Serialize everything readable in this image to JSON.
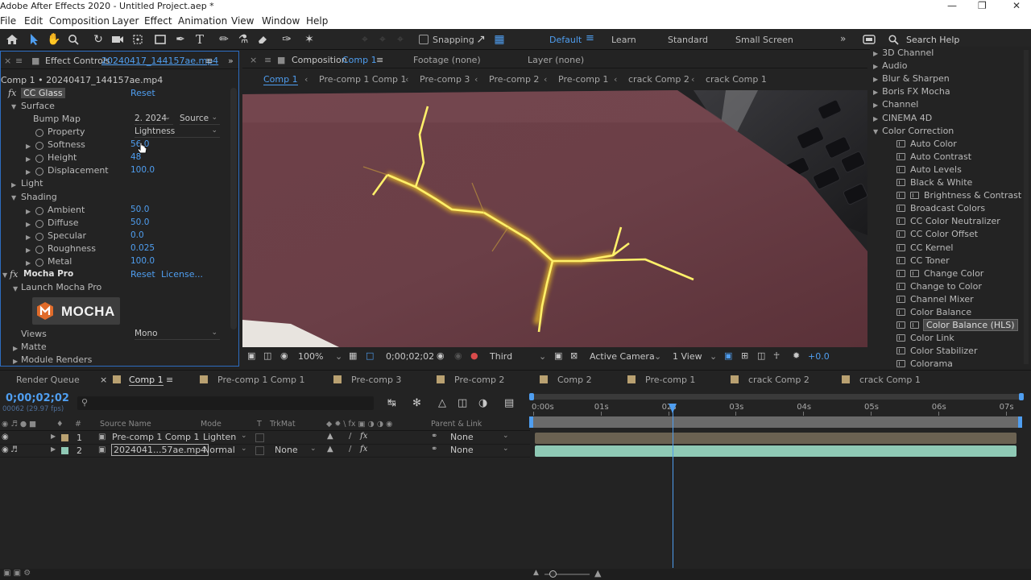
{
  "window": {
    "title": "Adobe After Effects 2020 - Untitled Project.aep *"
  },
  "menu": [
    "File",
    "Edit",
    "Composition",
    "Layer",
    "Effect",
    "Animation",
    "View",
    "Window",
    "Help"
  ],
  "toolbar": {
    "snapping": "Snapping",
    "workspaces": [
      "Default",
      "Learn",
      "Standard",
      "Small Screen"
    ],
    "search_placeholder": "Search Help"
  },
  "effect_controls": {
    "tab_prefix": "Effect Controls",
    "tab_file": "20240417_144157ae.mp4",
    "subtitle": "Comp 1 • 20240417_144157ae.mp4",
    "cc_glass": {
      "name": "CC Glass",
      "reset": "Reset",
      "surface": "Surface",
      "bump_map_label": "Bump Map",
      "bump_map_value": "2. 2024",
      "bump_map_source": "Source",
      "property_label": "Property",
      "property_value": "Lightness",
      "softness_label": "Softness",
      "softness_value": "56.0",
      "height_label": "Height",
      "height_value": "48",
      "displacement_label": "Displacement",
      "displacement_value": "100.0",
      "light": "Light",
      "shading": "Shading",
      "ambient_label": "Ambient",
      "ambient_value": "50.0",
      "diffuse_label": "Diffuse",
      "diffuse_value": "50.0",
      "specular_label": "Specular",
      "specular_value": "0.0",
      "roughness_label": "Roughness",
      "roughness_value": "0.025",
      "metal_label": "Metal",
      "metal_value": "100.0"
    },
    "mocha": {
      "name": "Mocha Pro",
      "reset": "Reset",
      "license": "License...",
      "launch": "Launch Mocha Pro",
      "logo_text": "MOCHA",
      "views_label": "Views",
      "views_value": "Mono",
      "matte": "Matte",
      "module_renders": "Module Renders"
    }
  },
  "composition": {
    "tab_prefix": "Composition",
    "tab_name": "Comp 1",
    "footage": "Footage (none)",
    "layer": "Layer (none)",
    "breadcrumbs": [
      "Comp 1",
      "Pre-comp 1 Comp 1",
      "Pre-comp 3",
      "Pre-comp 2",
      "Pre-comp 1",
      "crack Comp 2",
      "crack Comp 1"
    ],
    "zoom": "100%",
    "timecode": "0;00;02;02",
    "resolution": "Third",
    "camera": "Active Camera",
    "views": "1 View",
    "exposure": "+0.0"
  },
  "effects_presets": {
    "categories_top": [
      "3D Channel",
      "Audio",
      "Blur & Sharpen",
      "Boris FX Mocha",
      "Channel",
      "CINEMA 4D",
      "Color Correction"
    ],
    "color_correction": [
      "Auto Color",
      "Auto Contrast",
      "Auto Levels",
      "Black & White",
      "Brightness & Contrast",
      "Broadcast Colors",
      "CC Color Neutralizer",
      "CC Color Offset",
      "CC Kernel",
      "CC Toner",
      "Change Color",
      "Change to Color",
      "Channel Mixer",
      "Color Balance",
      "Color Balance (HLS)",
      "Color Link",
      "Color Stabilizer",
      "Colorama"
    ],
    "selected": "Color Balance (HLS)"
  },
  "timeline": {
    "tabs": [
      "Render Queue",
      "Comp 1",
      "Pre-comp 1 Comp 1",
      "Pre-comp 3",
      "Pre-comp 2",
      "Comp 2",
      "Pre-comp 1",
      "crack Comp 2",
      "crack Comp 1"
    ],
    "timecode": "0;00;02;02",
    "frame_info": "00062 (29.97 fps)",
    "columns": {
      "source": "Source Name",
      "mode": "Mode",
      "t": "T",
      "trkmat": "TrkMat",
      "parent": "Parent & Link"
    },
    "layers": [
      {
        "num": "1",
        "name": "Pre-comp 1 Comp 1",
        "mode": "Lighten",
        "trkmat": "",
        "parent": "None",
        "color": "#b9a171"
      },
      {
        "num": "2",
        "name": "2024041...57ae.mp4",
        "mode": "Normal",
        "trkmat": "None",
        "parent": "None",
        "color": "#8fc9b5"
      }
    ],
    "ruler": [
      "0:00s",
      "01s",
      "02s",
      "03s",
      "04s",
      "05s",
      "06s",
      "07s"
    ],
    "playhead_seconds": 2.07
  }
}
